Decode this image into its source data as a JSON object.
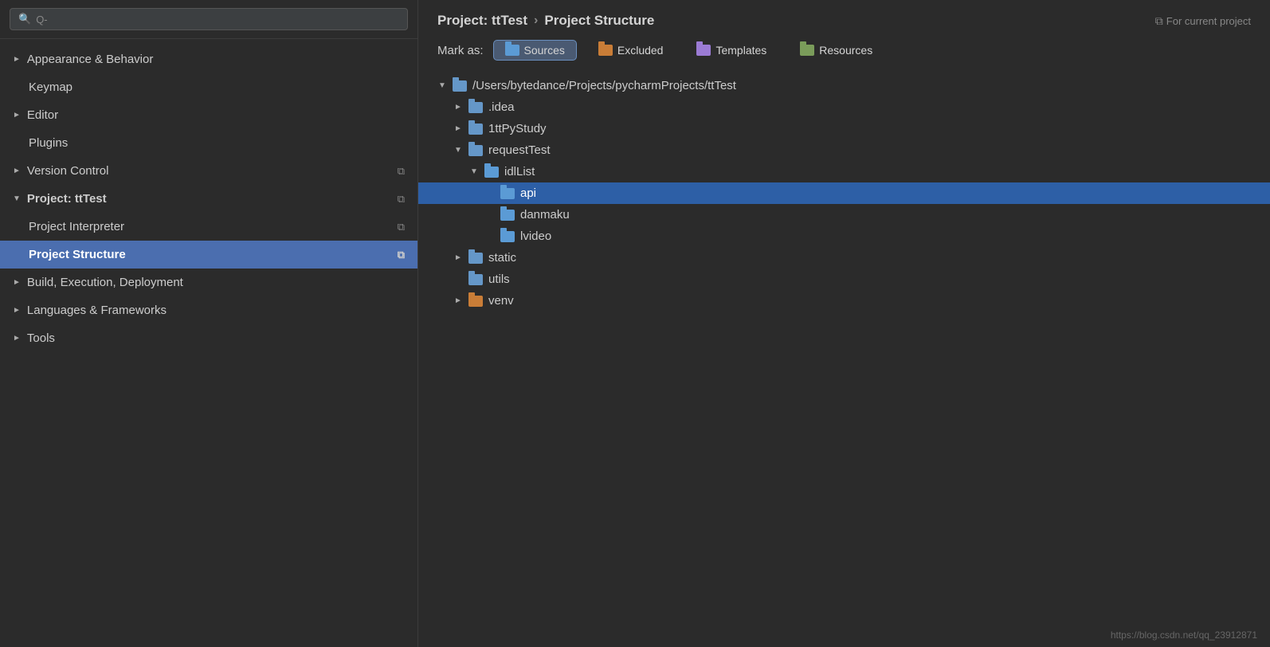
{
  "sidebar": {
    "search": {
      "placeholder": "Q-",
      "value": ""
    },
    "items": [
      {
        "id": "appearance",
        "label": "Appearance & Behavior",
        "hasArrow": true,
        "arrowDir": "right",
        "indent": 0,
        "active": false,
        "hasIcon": false
      },
      {
        "id": "keymap",
        "label": "Keymap",
        "hasArrow": false,
        "indent": 1,
        "active": false,
        "hasIcon": false
      },
      {
        "id": "editor",
        "label": "Editor",
        "hasArrow": true,
        "arrowDir": "right",
        "indent": 0,
        "active": false,
        "hasIcon": false
      },
      {
        "id": "plugins",
        "label": "Plugins",
        "hasArrow": false,
        "indent": 1,
        "active": false,
        "hasIcon": false
      },
      {
        "id": "version-control",
        "label": "Version Control",
        "hasArrow": true,
        "arrowDir": "right",
        "indent": 0,
        "active": false,
        "hasCopyIcon": true
      },
      {
        "id": "project-tttest",
        "label": "Project: ttTest",
        "hasArrow": true,
        "arrowDir": "down",
        "indent": 0,
        "active": false,
        "bold": true,
        "hasCopyIcon": true
      },
      {
        "id": "project-interpreter",
        "label": "Project Interpreter",
        "hasArrow": false,
        "indent": 1,
        "active": false,
        "hasCopyIcon": true
      },
      {
        "id": "project-structure",
        "label": "Project Structure",
        "hasArrow": false,
        "indent": 1,
        "active": true,
        "bold": true,
        "hasCopyIcon": true
      },
      {
        "id": "build-execution",
        "label": "Build, Execution, Deployment",
        "hasArrow": true,
        "arrowDir": "right",
        "indent": 0,
        "active": false
      },
      {
        "id": "languages-frameworks",
        "label": "Languages & Frameworks",
        "hasArrow": true,
        "arrowDir": "right",
        "indent": 0,
        "active": false
      },
      {
        "id": "tools",
        "label": "Tools",
        "hasArrow": true,
        "arrowDir": "right",
        "indent": 0,
        "active": false
      }
    ]
  },
  "header": {
    "breadcrumb_part1": "Project: ttTest",
    "breadcrumb_sep": "›",
    "breadcrumb_part2": "Project Structure",
    "for_current_project": "For current project"
  },
  "mark_as": {
    "label": "Mark as:",
    "buttons": [
      {
        "id": "sources",
        "label": "Sources",
        "folderColor": "sources-blue",
        "underline": "S",
        "active": true
      },
      {
        "id": "excluded",
        "label": "Excluded",
        "folderColor": "brown",
        "underline": "E",
        "active": false
      },
      {
        "id": "templates",
        "label": "Templates",
        "folderColor": "purple",
        "underline": "T",
        "active": false
      },
      {
        "id": "resources",
        "label": "Resources",
        "folderColor": "multi",
        "underline": "R",
        "active": false
      }
    ]
  },
  "tree": {
    "items": [
      {
        "id": "root",
        "label": "/Users/bytedance/Projects/pycharmProjects/ttTest",
        "arrow": "▼",
        "indent": 0,
        "folderColor": "blue",
        "selected": false
      },
      {
        "id": "idea",
        "label": ".idea",
        "arrow": "►",
        "indent": 1,
        "folderColor": "blue",
        "selected": false
      },
      {
        "id": "1ttpystudy",
        "label": "1ttPyStudy",
        "arrow": "►",
        "indent": 1,
        "folderColor": "blue",
        "selected": false
      },
      {
        "id": "requesttest",
        "label": "requestTest",
        "arrow": "▼",
        "indent": 1,
        "folderColor": "blue",
        "selected": false
      },
      {
        "id": "idllist",
        "label": "idlList",
        "arrow": "▼",
        "indent": 2,
        "folderColor": "sources-blue",
        "selected": false
      },
      {
        "id": "api",
        "label": "api",
        "arrow": "",
        "indent": 3,
        "folderColor": "sources-blue",
        "selected": true
      },
      {
        "id": "danmaku",
        "label": "danmaku",
        "arrow": "",
        "indent": 3,
        "folderColor": "sources-blue",
        "selected": false
      },
      {
        "id": "lvideo",
        "label": "lvideo",
        "arrow": "",
        "indent": 3,
        "folderColor": "sources-blue",
        "selected": false
      },
      {
        "id": "static",
        "label": "static",
        "arrow": "►",
        "indent": 1,
        "folderColor": "blue",
        "selected": false
      },
      {
        "id": "utils",
        "label": "utils",
        "arrow": "",
        "indent": 1,
        "folderColor": "blue",
        "selected": false
      },
      {
        "id": "venv",
        "label": "venv",
        "arrow": "►",
        "indent": 1,
        "folderColor": "brown",
        "selected": false
      }
    ]
  },
  "footer": {
    "link": "https://blog.csdn.net/qq_23912871"
  }
}
